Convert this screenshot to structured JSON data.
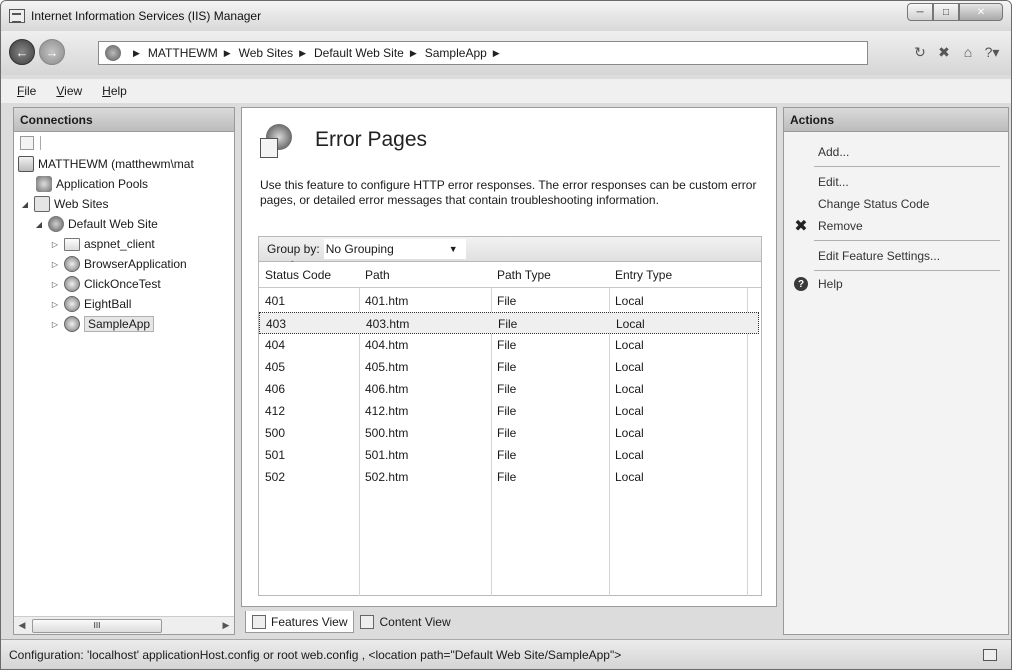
{
  "window": {
    "title": "Internet Information Services (IIS) Manager"
  },
  "breadcrumbs": [
    "MATTHEWM",
    "Web Sites",
    "Default Web Site",
    "SampleApp"
  ],
  "menu": [
    {
      "underline": "F",
      "rest": "ile"
    },
    {
      "underline": "V",
      "rest": "iew"
    },
    {
      "underline": "H",
      "rest": "elp"
    }
  ],
  "connections": {
    "header": "Connections",
    "tree": {
      "server": "MATTHEWM (matthewm\\mat",
      "app_pools": "Application Pools",
      "web_sites": "Web Sites",
      "default_site": "Default Web Site",
      "children": [
        "aspnet_client",
        "BrowserApplication",
        "ClickOnceTest",
        "EightBall",
        "SampleApp"
      ]
    },
    "scroll_thumb": "III"
  },
  "feature": {
    "title": "Error Pages",
    "description": "Use this feature to configure HTTP error responses.  The error responses can be custom error pages, or detailed error messages that contain troubleshooting information.",
    "group_by_label": "Group by:",
    "group_by_value": "No Grouping"
  },
  "table": {
    "columns": [
      "Status Code",
      "Path",
      "Path Type",
      "Entry Type"
    ],
    "rows": [
      [
        "401",
        "401.htm",
        "File",
        "Local"
      ],
      [
        "403",
        "403.htm",
        "File",
        "Local"
      ],
      [
        "404",
        "404.htm",
        "File",
        "Local"
      ],
      [
        "405",
        "405.htm",
        "File",
        "Local"
      ],
      [
        "406",
        "406.htm",
        "File",
        "Local"
      ],
      [
        "412",
        "412.htm",
        "File",
        "Local"
      ],
      [
        "500",
        "500.htm",
        "File",
        "Local"
      ],
      [
        "501",
        "501.htm",
        "File",
        "Local"
      ],
      [
        "502",
        "502.htm",
        "File",
        "Local"
      ]
    ],
    "selected_row": 1
  },
  "view_tabs": {
    "features": "Features View",
    "content": "Content View"
  },
  "actions": {
    "header": "Actions",
    "add": "Add...",
    "edit": "Edit...",
    "change_status": "Change Status Code",
    "remove": "Remove",
    "edit_feature": "Edit Feature Settings...",
    "help": "Help"
  },
  "status": {
    "text": "Configuration: 'localhost' applicationHost.config or root web.config , <location path=\"Default Web Site/SampleApp\">"
  }
}
